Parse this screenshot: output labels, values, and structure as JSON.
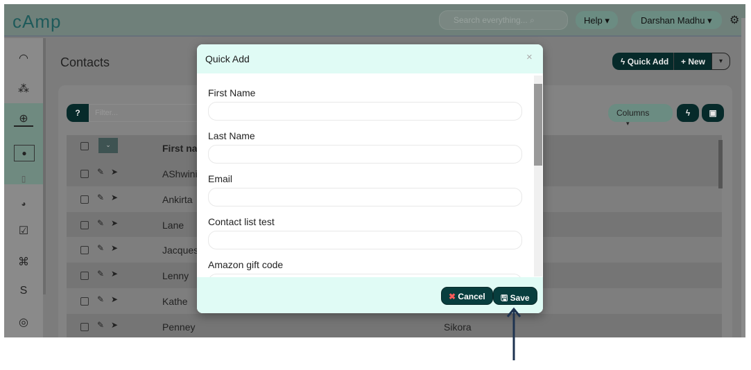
{
  "header": {
    "logo": "cAmp",
    "search_placeholder": "Search everything...",
    "help": "Help",
    "user": "Darshan Madhu"
  },
  "sidebar": {
    "icons": [
      "dashboard-icon",
      "org-chart-icon",
      "target-icon",
      "contacts-icon",
      "tablet-icon",
      "pie-chart-icon",
      "forms-icon",
      "network-icon",
      "route-icon",
      "goal-icon"
    ]
  },
  "page": {
    "title": "Contacts",
    "quick_add": "Quick Add",
    "new": "+ New",
    "filter_placeholder": "Filter...",
    "columns": "Columns"
  },
  "table": {
    "header": "First name",
    "rows": [
      {
        "first": "AShwini",
        "last": ""
      },
      {
        "first": "Ankirta",
        "last": ""
      },
      {
        "first": "Lane",
        "last": ""
      },
      {
        "first": "Jacques",
        "last": ""
      },
      {
        "first": "Lenny",
        "last": ""
      },
      {
        "first": "Kathe",
        "last": ""
      },
      {
        "first": "Penney",
        "last": "Sikora"
      }
    ]
  },
  "modal": {
    "title": "Quick Add",
    "close": "×",
    "fields": [
      {
        "label": "First Name",
        "value": ""
      },
      {
        "label": "Last Name",
        "value": ""
      },
      {
        "label": "Email",
        "value": ""
      },
      {
        "label": "Contact list test",
        "value": ""
      },
      {
        "label": "Amazon gift code",
        "value": ""
      }
    ],
    "cancel": "Cancel",
    "save": "Save"
  },
  "colors": {
    "accent": "#083e3e",
    "modal_header": "#e0fbf5",
    "arrow": "#1e3350"
  }
}
